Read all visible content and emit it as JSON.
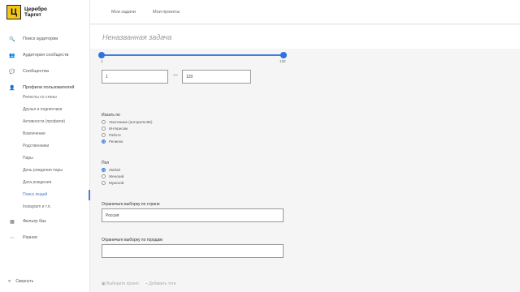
{
  "logo": {
    "letter": "Ц",
    "line1": "Церебро",
    "line2": "Таргет"
  },
  "nav": [
    {
      "icon": "🔍",
      "label": "Поиск аудитории"
    },
    {
      "icon": "👥",
      "label": "Аудитория сообществ"
    },
    {
      "icon": "💬",
      "label": "Сообщества"
    },
    {
      "icon": "👤",
      "label": "Профили пользователей"
    }
  ],
  "subnav": [
    "Репосты со стены",
    "Друзья и подписчики",
    "Активности (профили)",
    "Вовлечение",
    "Родственники",
    "Пары",
    "День рождения пары",
    "Дата рождения",
    "Поиск людей",
    "Instagram и т.п."
  ],
  "nav2": [
    {
      "icon": "▦",
      "label": "Фильтр баз"
    },
    {
      "icon": "⋯",
      "label": "Разное"
    }
  ],
  "collapse": {
    "icon": "«",
    "label": "Свернуть"
  },
  "topbar": {
    "tab1": "Мои задачи",
    "tab2": "Мои проекты"
  },
  "task_title": "Неназванная задача",
  "slider": {
    "min_label": "1",
    "max_label": "120",
    "from": "1",
    "to": "120",
    "separator": "—"
  },
  "search_by": {
    "label": "Искать по",
    "options": [
      "Умолчание (алгоритм ВК)",
      "Интересам",
      "Работе",
      "Религии"
    ],
    "selected_index": 3
  },
  "gender": {
    "label": "Пол",
    "options": [
      "Любой",
      "Женский",
      "Мужской"
    ],
    "selected_index": 0
  },
  "country": {
    "label": "Ограничьте выборку по стране",
    "value": "Россия"
  },
  "cities": {
    "label": "Ограничьте выборку по городам",
    "value": ""
  },
  "bottom": {
    "link1": "Выберите проект",
    "link2": "Добавить теги"
  }
}
